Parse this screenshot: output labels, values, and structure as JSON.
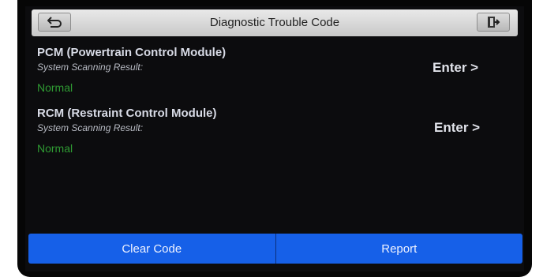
{
  "header": {
    "title": "Diagnostic Trouble Code",
    "back_icon": "back-arrow-icon",
    "exit_icon": "exit-icon"
  },
  "modules": [
    {
      "name": "PCM (Powertrain Control Module)",
      "result_label": "System Scanning Result:",
      "status": "Normal",
      "enter_label": "Enter >"
    },
    {
      "name": "RCM (Restraint Control Module)",
      "result_label": "System Scanning Result:",
      "status": "Normal",
      "enter_label": "Enter >"
    }
  ],
  "footer": {
    "clear_code_label": "Clear Code",
    "report_label": "Report"
  },
  "colors": {
    "status_normal": "#2f9b33",
    "button_blue": "#1660e8"
  }
}
